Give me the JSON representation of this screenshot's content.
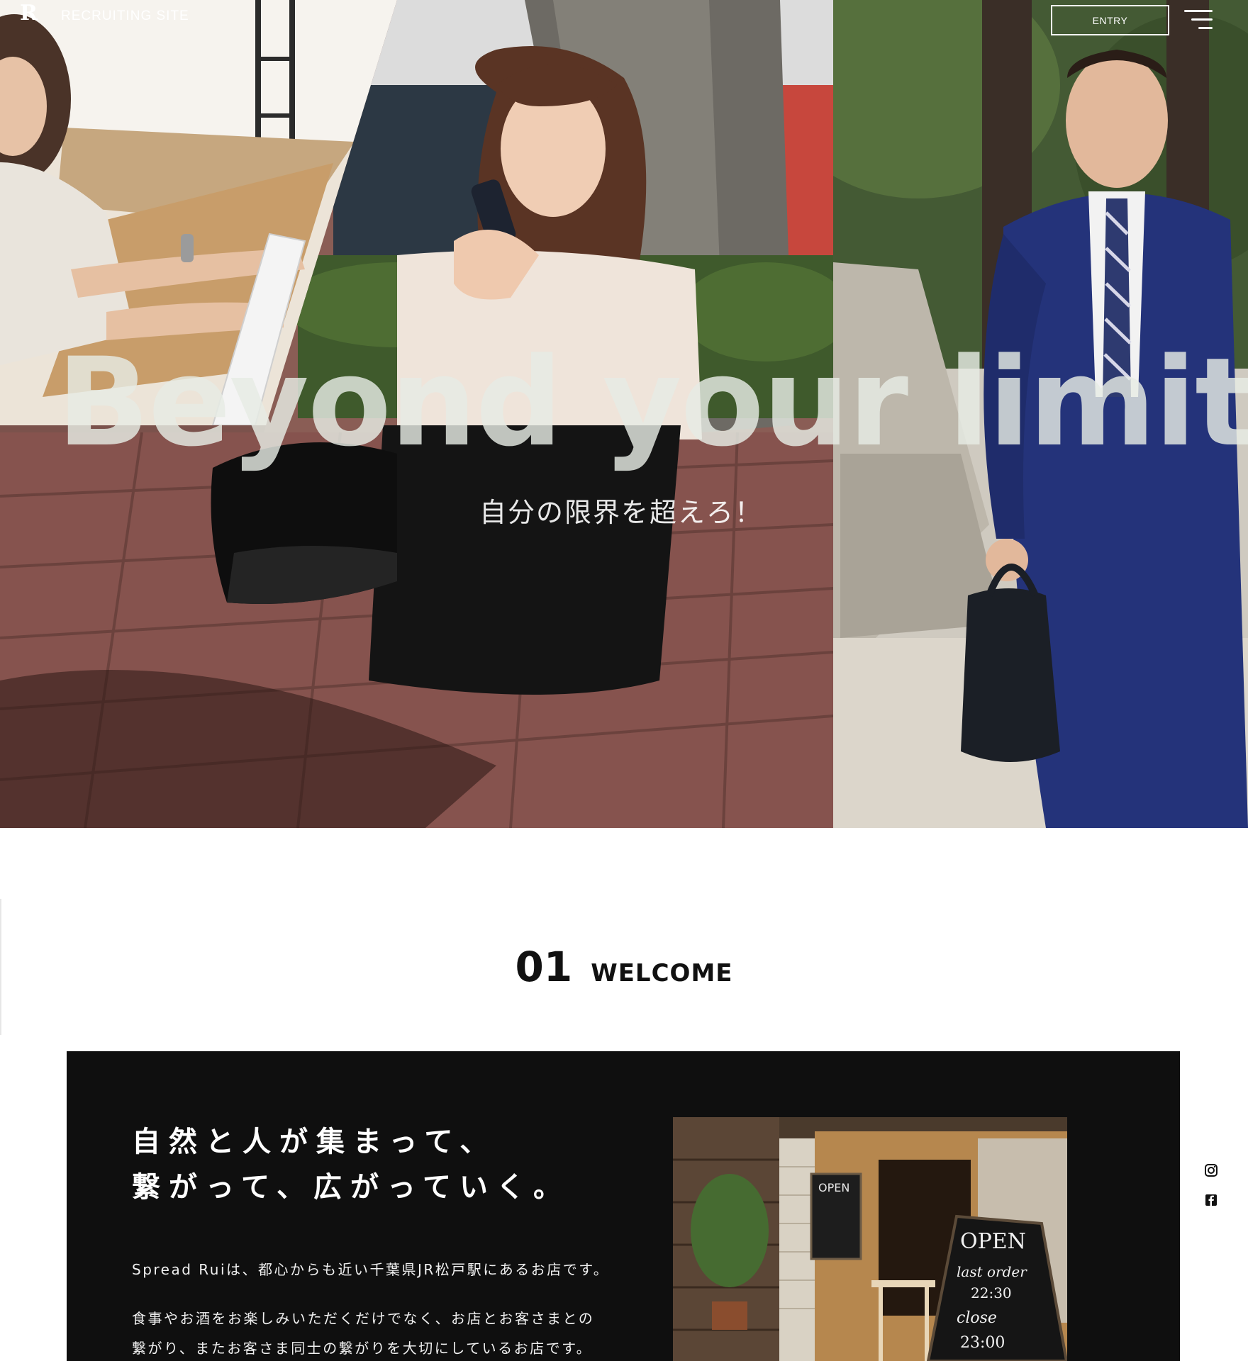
{
  "header": {
    "logo_letters": "R",
    "site_title": "RECRUITING SITE",
    "entry_label": "ENTRY",
    "menu_icon": "hamburger-menu-icon"
  },
  "hero": {
    "headline": "Beyond your limits",
    "subheadline": "自分の限界を超えろ！"
  },
  "welcome": {
    "number": "01",
    "title": "WELCOME",
    "heading_lines": [
      "自然と人が集まって、",
      "繋がって、広がっていく。"
    ],
    "paragraph1": "Spread Ruiは、都心からも近い千葉県JR松戸駅にあるお店です。",
    "paragraph2_lines": [
      "食事やお酒をお楽しみいただくだけでなく、お店とお客さまとの",
      "繋がり、またお客さま同士の繋がりを大切にしているお店です。"
    ],
    "photo": {
      "sign_top": "OPEN",
      "sign_main_1": "OPEN",
      "sign_main_2": "last order",
      "sign_main_3": "22:30",
      "sign_main_4": "close",
      "sign_main_5": "23:00"
    }
  },
  "social": {
    "icons": [
      "instagram-icon",
      "facebook-icon"
    ]
  },
  "colors": {
    "card_background": "#0f0f0f",
    "text_dark": "#111111",
    "white": "#ffffff"
  }
}
